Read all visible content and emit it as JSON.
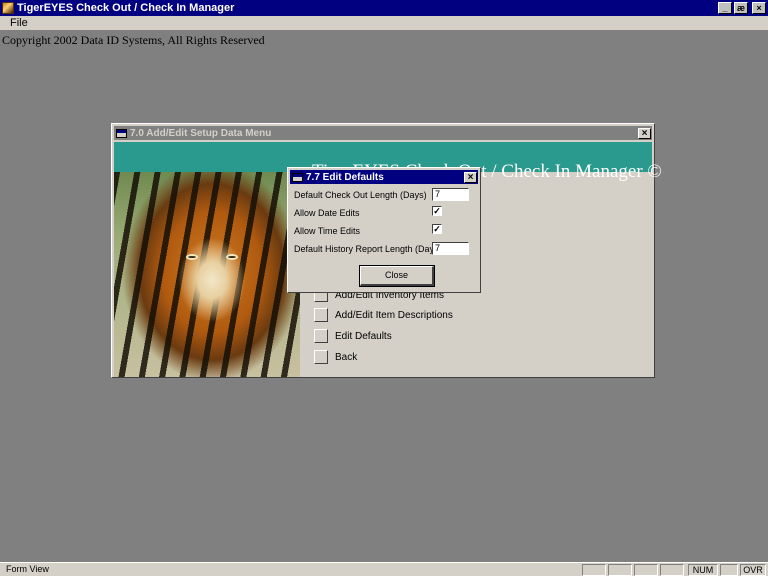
{
  "app": {
    "title": "TigerEYES Check Out / Check In Manager",
    "window_buttons": [
      "_",
      "æ",
      "×"
    ]
  },
  "menubar": {
    "file_label": "File"
  },
  "copyright": "Copyright 2002 Data ID Systems, All Rights Reserved",
  "setup_form": {
    "title": "7.0 Add/Edit Setup Data Menu",
    "close_label": "×",
    "banner_title": "TigerEYES Check Out / Check In Manager ©",
    "items": [
      {
        "label": "Add/Edit Inventory Items"
      },
      {
        "label": "Add/Edit Item Descriptions"
      },
      {
        "label": "Edit Defaults"
      },
      {
        "label": "Back"
      }
    ]
  },
  "dialog": {
    "title": "7.7 Edit Defaults",
    "close_label": "×",
    "checkout_length_label": "Default Check Out Length (Days)",
    "checkout_length_value": "7",
    "allow_date_edits_label": "Allow Date Edits",
    "allow_date_edits_checked": true,
    "allow_time_edits_label": "Allow Time Edits",
    "allow_time_edits_checked": true,
    "history_length_label": "Default History Report Length (Days)",
    "history_length_value": "7",
    "close_button_label": "Close"
  },
  "statusbar": {
    "text": "Form View",
    "num": "NUM",
    "ovr": "OVR"
  }
}
